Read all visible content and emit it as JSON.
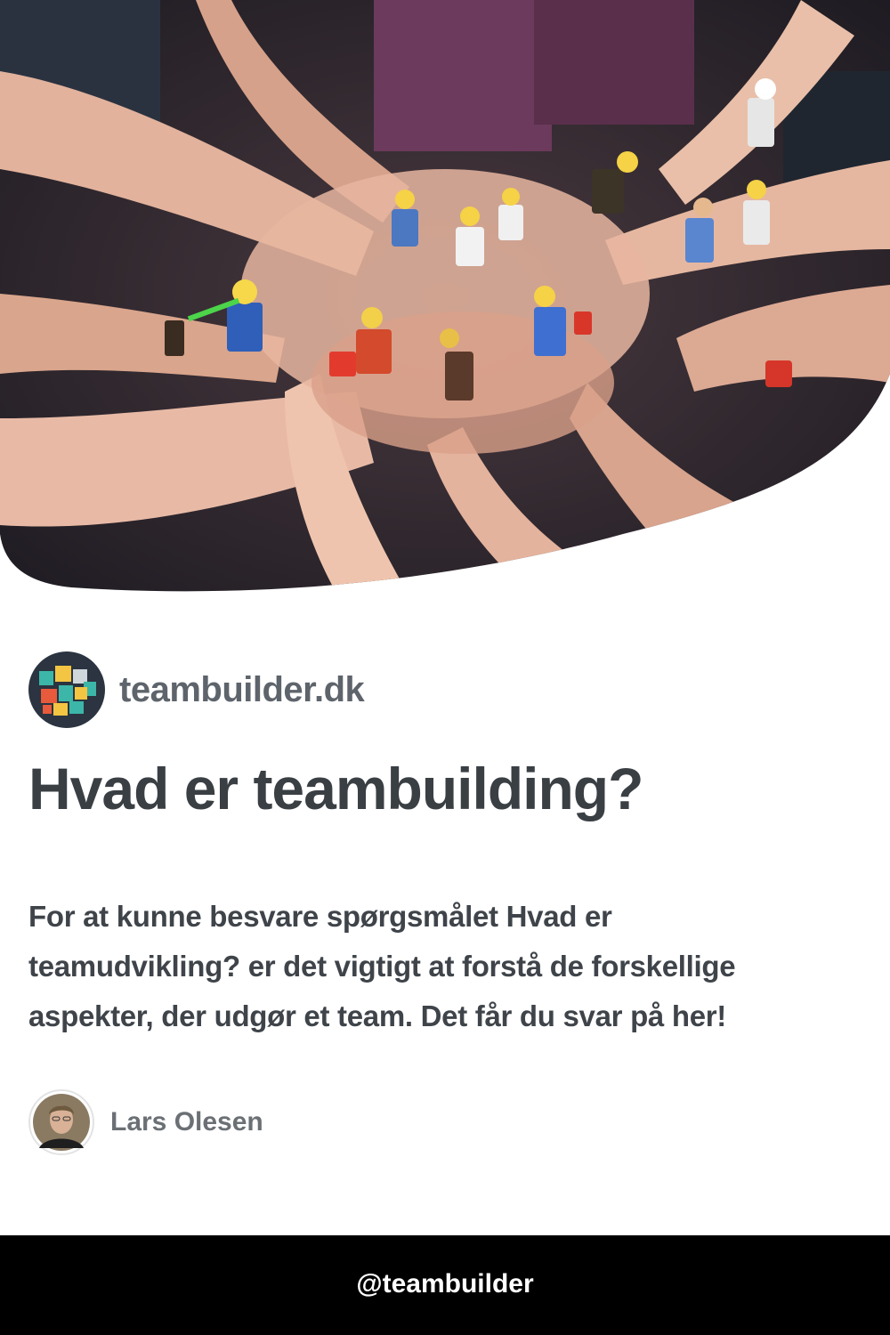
{
  "hero": {
    "image_description_icon": "team-hands-minifigures-photo"
  },
  "brand": {
    "logo_icon": "teambuilder-logo-icon",
    "name": "teambuilder.dk"
  },
  "article": {
    "title": "Hvad er teambuilding?",
    "description": "For at kunne besvare spørgsmålet Hvad er teamudvikling? er det vigtigt at forstå de forskellige aspekter, der udgør et team. Det får du svar på her!"
  },
  "author": {
    "name": "Lars Olesen"
  },
  "footer": {
    "handle": "@teambuilder"
  },
  "colors": {
    "text_primary": "#3a3f44",
    "text_muted": "#6b7075",
    "footer_bg": "#000000"
  }
}
